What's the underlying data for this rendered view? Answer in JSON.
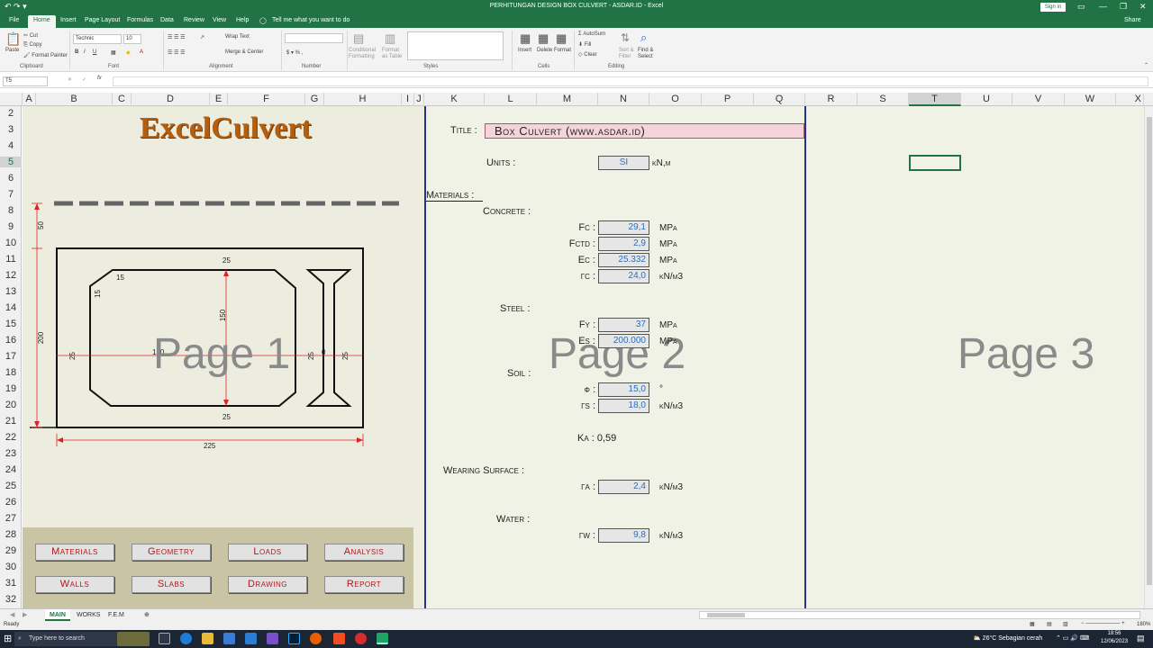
{
  "window": {
    "title": "PERHITUNGAN DESIGN BOX CULVERT - ASDAR.ID  -  Excel",
    "sign_in": "Sign in",
    "quick_access": "↶ ↷ ▾"
  },
  "menu": {
    "tabs": [
      "File",
      "Home",
      "Insert",
      "Page Layout",
      "Formulas",
      "Data",
      "Review",
      "View",
      "Help"
    ],
    "tell_me": "Tell me what you want to do",
    "share": "Share"
  },
  "ribbon": {
    "paste": "Paste",
    "cut": "Cut",
    "copy": "Copy",
    "format_painter": "Format Painter",
    "font_name": "Technic",
    "font_size": "10",
    "wrap_text": "Wrap Text",
    "merge_center": "Merge & Center",
    "conditional_formatting": "Conditional Formatting",
    "format_as_table": "Format as Table",
    "insert": "Insert",
    "delete": "Delete",
    "format": "Format",
    "autosum": "AutoSum",
    "fill": "Fill",
    "clear": "Clear",
    "sort_filter": "Sort & Filter",
    "find_select": "Find & Select",
    "groups": [
      "Clipboard",
      "Font",
      "Alignment",
      "Number",
      "Styles",
      "Cells",
      "Editing"
    ]
  },
  "formula_bar": {
    "name_box": "T5",
    "fx": "fx",
    "value": ""
  },
  "columns": [
    "A",
    "B",
    "C",
    "D",
    "E",
    "F",
    "G",
    "H",
    "I",
    "J",
    "K",
    "L",
    "M",
    "N",
    "O",
    "P",
    "Q",
    "R",
    "S",
    "T",
    "U",
    "V",
    "W",
    "X"
  ],
  "rows": [
    "2",
    "3",
    "4",
    "5",
    "6",
    "7",
    "8",
    "9",
    "10",
    "11",
    "12",
    "13",
    "14",
    "15",
    "16",
    "17",
    "18",
    "19",
    "20",
    "21",
    "22",
    "23",
    "24",
    "25",
    "26",
    "27",
    "28",
    "29",
    "30",
    "31",
    "32"
  ],
  "page1": {
    "logo": "ExcelCulvert",
    "watermark": "Page 1",
    "dims": {
      "top": "50",
      "height": "200",
      "width": "225",
      "slab_top": "25",
      "slab_bottom": "25",
      "wall_left": "25",
      "wall_right": "25",
      "haunch_h": "15",
      "haunch_v": "15",
      "inner_h": "150",
      "inner_w": "150",
      "mid": "0"
    },
    "buttons": [
      "Materials",
      "Geometry",
      "Loads",
      "Analysis",
      "Walls",
      "Slabs",
      "Drawing",
      "Report"
    ]
  },
  "page2": {
    "watermark": "Page 2",
    "title_label": "Title :",
    "title_value": "Box Culvert (www.asdar.id)",
    "units_label": "Units :",
    "units_value": "SI",
    "units_unit": "kN,m",
    "materials_label": "Materials :",
    "concrete_label": "Concrete :",
    "fc_label": "Fc :",
    "fc_value": "29,1",
    "fc_unit": "MPa",
    "fctd_label": "Fctd :",
    "fctd_value": "2,9",
    "fctd_unit": "MPa",
    "ec_label": "Ec :",
    "ec_value": "25.332",
    "ec_unit": "MPa",
    "yc_label": "γc :",
    "yc_value": "24,0",
    "yc_unit": "kN/m3",
    "steel_label": "Steel :",
    "fy_label": "Fy :",
    "fy_value": "37",
    "fy_unit": "MPa",
    "es_label": "Es :",
    "es_value": "200.000",
    "es_unit": "MPa",
    "soil_label": "Soil :",
    "phi_label": "φ :",
    "phi_value": "15,0",
    "phi_unit": "°",
    "ys_label": "γs :",
    "ys_value": "18,0",
    "ys_unit": "kN/m3",
    "ka_text": "Ka : 0,59",
    "wearing_label": "Wearing Surface :",
    "ya_label": "γa :",
    "ya_value": "2,4",
    "ya_unit": "kN/m3",
    "water_label": "Water :",
    "yw_label": "γw :",
    "yw_value": "9,8",
    "yw_unit": "kN/m3"
  },
  "page3": {
    "watermark": "Page 3"
  },
  "sheet_tabs": [
    "MAIN",
    "WORKS",
    "F.E.M"
  ],
  "status": {
    "ready": "Ready",
    "zoom": "180%"
  },
  "taskbar": {
    "search": "Type here to search",
    "weather": "26°C  Sebagian cerah",
    "time": "18:56",
    "date": "12/06/2023"
  },
  "colors": {
    "excel_green": "#217346",
    "page_border": "#27348b",
    "button_text": "#b01818",
    "value_text": "#2e6fb3",
    "logo": "#b45f10"
  }
}
